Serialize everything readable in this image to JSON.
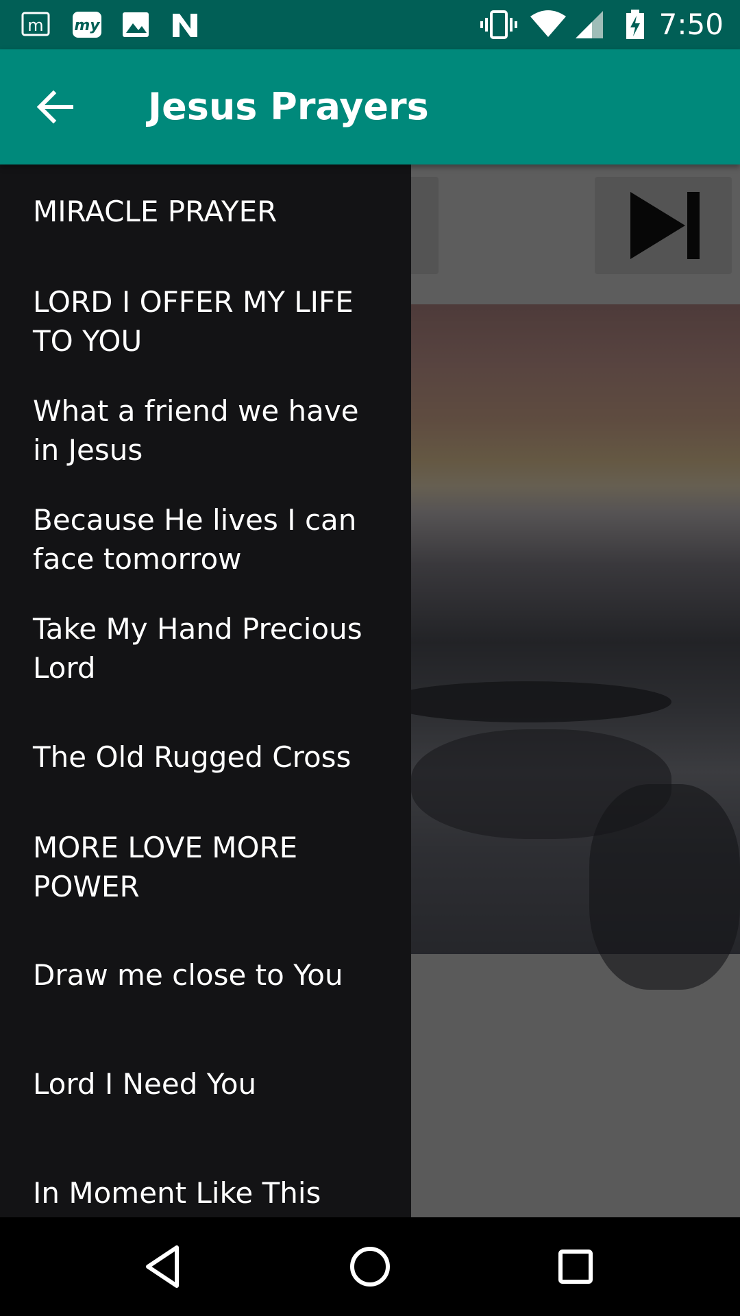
{
  "status_bar": {
    "time": "7:50",
    "left_icons": [
      "m-app-icon",
      "my-app-icon",
      "image-icon",
      "n-app-icon"
    ],
    "right_icons": [
      "vibrate-icon",
      "wifi-icon",
      "signal-icon",
      "battery-charging-icon"
    ]
  },
  "app_bar": {
    "title": "Jesus Prayers",
    "back_icon": "arrow-back-icon",
    "color": "#00897b"
  },
  "drawer": {
    "items": [
      {
        "label": "MIRACLE PRAYER"
      },
      {
        "label": "LORD I OFFER MY LIFE TO YOU"
      },
      {
        "label": "What a friend we have in Jesus"
      },
      {
        "label": "Because He lives I can face tomorrow"
      },
      {
        "label": "Take My Hand Precious Lord"
      },
      {
        "label": "The Old Rugged Cross"
      },
      {
        "label": "MORE LOVE MORE POWER"
      },
      {
        "label": "Draw me close to You"
      },
      {
        "label": "Lord I Need You"
      },
      {
        "label": "In Moment Like This"
      }
    ]
  },
  "player": {
    "next_icon": "skip-next-icon"
  },
  "nav_bar": {
    "icons": [
      "back-triangle-icon",
      "home-circle-icon",
      "recents-square-icon"
    ]
  }
}
